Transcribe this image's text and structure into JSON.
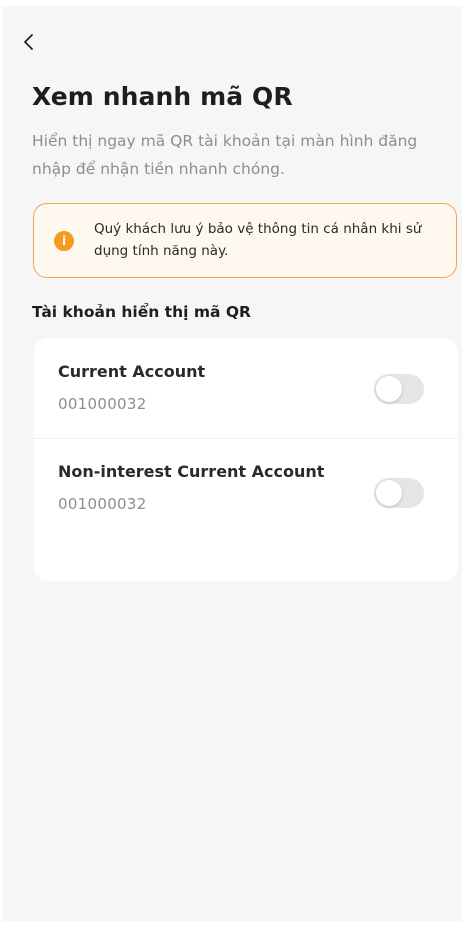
{
  "header": {
    "back_icon": "chevron-left-icon"
  },
  "page": {
    "title": "Xem nhanh mã QR",
    "description": "Hiển thị ngay mã QR tài khoản tại màn hình đăng nhập để nhận tiền nhanh chóng."
  },
  "notice": {
    "icon": "info-icon",
    "icon_glyph": "i",
    "text": "Quý khách lưu ý bảo vệ thông tin cá nhân khi sử dụng tính năng này.",
    "border_color": "#f3a54c",
    "icon_color": "#f59a23"
  },
  "accounts_section": {
    "title": "Tài khoản hiển thị mã QR",
    "items": [
      {
        "name": "Current Account",
        "number": "001000032",
        "enabled": false
      },
      {
        "name": "Non-interest Current Account",
        "number": "001000032",
        "enabled": false
      }
    ]
  }
}
